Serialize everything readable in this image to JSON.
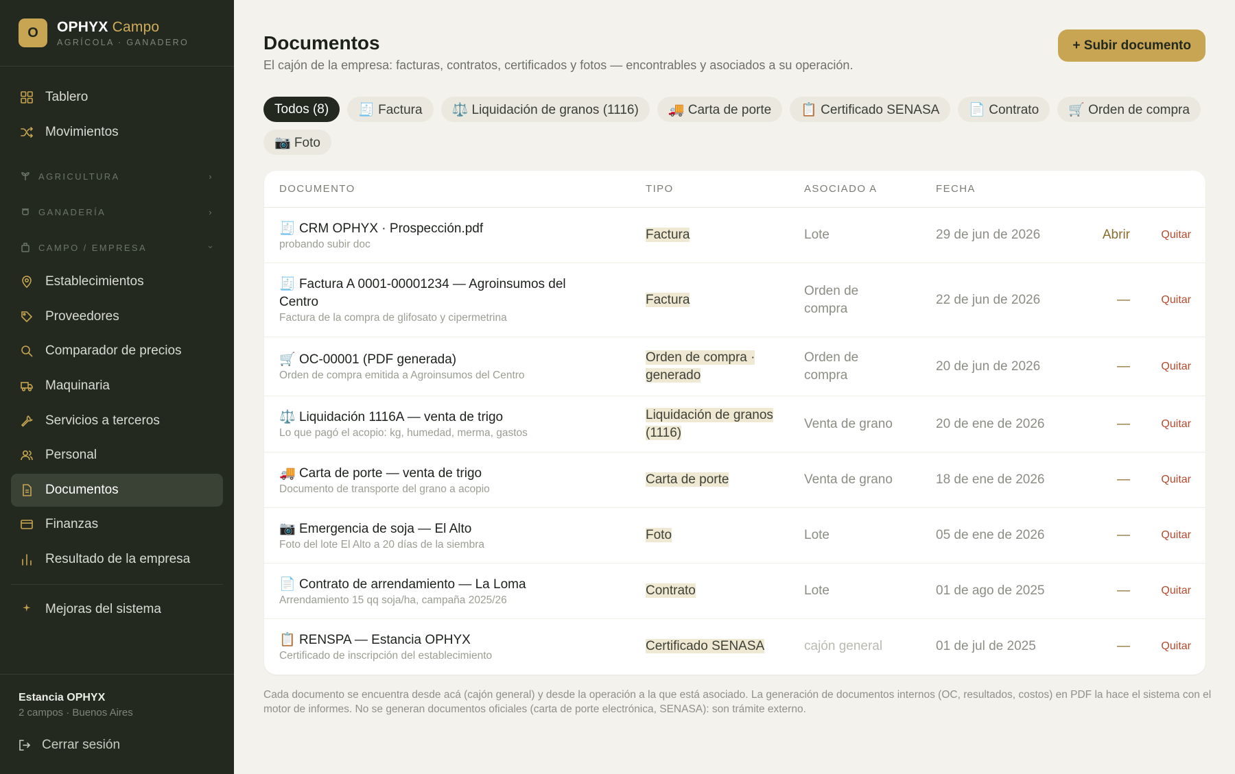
{
  "brand": {
    "logo_letter": "O",
    "name": "OPHYX",
    "accent": "Campo",
    "tagline": "AGRÍCOLA · GANADERO"
  },
  "nav": {
    "tablero": "Tablero",
    "movimientos": "Movimientos",
    "agricultura": "AGRICULTURA",
    "ganaderia": "GANADERÍA",
    "campo_empresa": "CAMPO / EMPRESA",
    "establecimientos": "Establecimientos",
    "proveedores": "Proveedores",
    "comparador": "Comparador de precios",
    "maquinaria": "Maquinaria",
    "servicios": "Servicios a terceros",
    "personal": "Personal",
    "documentos": "Documentos",
    "finanzas": "Finanzas",
    "resultado": "Resultado de la empresa",
    "mejoras": "Mejoras del sistema"
  },
  "account": {
    "name": "Estancia OPHYX",
    "detail": "2 campos · Buenos Aires",
    "logout": "Cerrar sesión"
  },
  "page": {
    "title": "Documentos",
    "subtitle": "El cajón de la empresa: facturas, contratos, certificados y fotos — encontrables y asociados a su operación.",
    "upload_button": "+ Subir documento"
  },
  "filters": [
    "Todos (8)",
    "🧾 Factura",
    "⚖️ Liquidación de granos (1116)",
    "🚚 Carta de porte",
    "📋 Certificado SENASA",
    "📄 Contrato",
    "🛒 Orden de compra",
    "📷 Foto"
  ],
  "table": {
    "headers": {
      "doc": "DOCUMENTO",
      "type": "TIPO",
      "assoc": "ASOCIADO A",
      "date": "FECHA"
    },
    "rows": [
      {
        "icon": "🧾",
        "title": "CRM OPHYX · Prospección.pdf",
        "desc": "probando subir doc",
        "type": "Factura",
        "assoc": "Lote",
        "date": "29 de jun de 2026",
        "action": "Abrir",
        "remove": "Quitar"
      },
      {
        "icon": "🧾",
        "title": "Factura A 0001-00001234 — Agroinsumos del Centro",
        "desc": "Factura de la compra de glifosato y cipermetrina",
        "type": "Factura",
        "assoc": "Orden de compra",
        "date": "22 de jun de 2026",
        "action": "—",
        "remove": "Quitar"
      },
      {
        "icon": "🛒",
        "title": "OC-00001 (PDF generada)",
        "desc": "Orden de compra emitida a Agroinsumos del Centro",
        "type": "Orden de compra · generado",
        "assoc": "Orden de compra",
        "date": "20 de jun de 2026",
        "action": "—",
        "remove": "Quitar"
      },
      {
        "icon": "⚖️",
        "title": "Liquidación 1116A — venta de trigo",
        "desc": "Lo que pagó el acopio: kg, humedad, merma, gastos",
        "type": "Liquidación de granos (1116)",
        "assoc": "Venta de grano",
        "date": "20 de ene de 2026",
        "action": "—",
        "remove": "Quitar"
      },
      {
        "icon": "🚚",
        "title": "Carta de porte — venta de trigo",
        "desc": "Documento de transporte del grano a acopio",
        "type": "Carta de porte",
        "assoc": "Venta de grano",
        "date": "18 de ene de 2026",
        "action": "—",
        "remove": "Quitar"
      },
      {
        "icon": "📷",
        "title": "Emergencia de soja — El Alto",
        "desc": "Foto del lote El Alto a 20 días de la siembra",
        "type": "Foto",
        "assoc": "Lote",
        "date": "05 de ene de 2026",
        "action": "—",
        "remove": "Quitar"
      },
      {
        "icon": "📄",
        "title": "Contrato de arrendamiento — La Loma",
        "desc": "Arrendamiento 15 qq soja/ha, campaña 2025/26",
        "type": "Contrato",
        "assoc": "Lote",
        "date": "01 de ago de 2025",
        "action": "—",
        "remove": "Quitar"
      },
      {
        "icon": "📋",
        "title": "RENSPA — Estancia OPHYX",
        "desc": "Certificado de inscripción del establecimiento",
        "type": "Certificado SENASA",
        "assoc": "cajón general",
        "date": "01 de jul de 2025",
        "action": "—",
        "remove": "Quitar"
      }
    ]
  },
  "footnote": "Cada documento se encuentra desde acá (cajón general) y desde la operación a la que está asociado. La generación de documentos internos (OC, resultados, costos) en PDF la hace el sistema con el motor de informes. No se generan documentos oficiales (carta de porte electrónica, SENASA): son trámite externo.",
  "colors": {
    "sidebar": "#23291f",
    "accent": "#c8a552",
    "background": "#f4f2ec",
    "danger": "#b34a2e"
  }
}
